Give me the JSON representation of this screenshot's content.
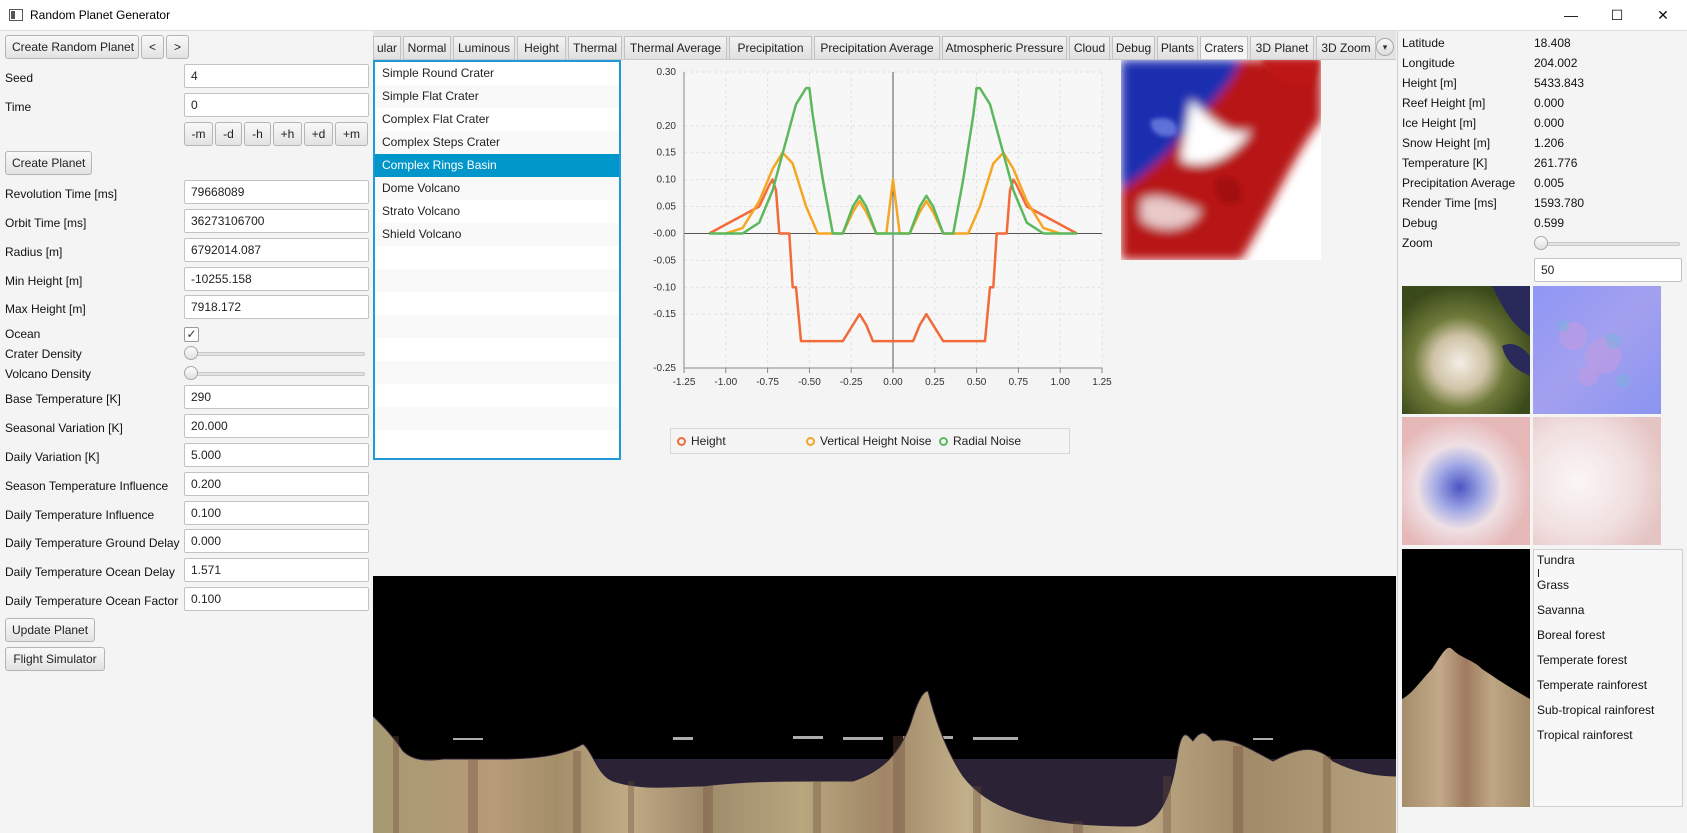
{
  "window": {
    "title": "Random Planet Generator",
    "minimize": "—",
    "maximize": "☐",
    "close": "✕"
  },
  "left": {
    "create_random_planet": "Create Random Planet",
    "prev": "<",
    "next": ">",
    "seed_label": "Seed",
    "seed_value": "4",
    "time_label": "Time",
    "time_value": "0",
    "time_buttons": [
      "-m",
      "-d",
      "-h",
      "+h",
      "+d",
      "+m"
    ],
    "create_planet": "Create Planet",
    "revolution_time_label": "Revolution Time [ms]",
    "revolution_time_value": "79668089",
    "orbit_time_label": "Orbit Time [ms]",
    "orbit_time_value": "36273106700",
    "radius_label": "Radius [m]",
    "radius_value": "6792014.087",
    "min_height_label": "Min Height [m]",
    "min_height_value": "-10255.158",
    "max_height_label": "Max Height [m]",
    "max_height_value": "7918.172",
    "ocean_label": "Ocean",
    "ocean_checked": "✓",
    "crater_density_label": "Crater Density",
    "crater_density_value": 0,
    "volcano_density_label": "Volcano Density",
    "volcano_density_value": 0,
    "base_temperature_label": "Base Temperature [K]",
    "base_temperature_value": "290",
    "seasonal_variation_label": "Seasonal Variation [K]",
    "seasonal_variation_value": "20.000",
    "daily_variation_label": "Daily Variation [K]",
    "daily_variation_value": "5.000",
    "season_temp_influence_label": "Season Temperature Influence",
    "season_temp_influence_value": "0.200",
    "daily_temp_influence_label": "Daily Temperature Influence",
    "daily_temp_influence_value": "0.100",
    "daily_temp_ground_delay_label": "Daily Temperature Ground Delay",
    "daily_temp_ground_delay_value": "0.000",
    "daily_temp_ocean_delay_label": "Daily Temperature Ocean Delay",
    "daily_temp_ocean_delay_value": "1.571",
    "daily_temp_ocean_factor_label": "Daily Temperature Ocean Factor",
    "daily_temp_ocean_factor_value": "0.100",
    "update_planet": "Update Planet",
    "flight_simulator": "Flight Simulator"
  },
  "tabs": [
    "ular",
    "Normal",
    "Luminous",
    "Height",
    "Thermal",
    "Thermal Average",
    "Precipitation",
    "Precipitation Average",
    "Atmospheric Pressure",
    "Cloud",
    "Debug",
    "Plants",
    "Craters",
    "3D Planet",
    "3D Zoom"
  ],
  "active_tab": "Craters",
  "tab_more_icon": "▾",
  "crater_list": {
    "items": [
      "Simple Round Crater",
      "Simple Flat Crater",
      "Complex Flat Crater",
      "Complex Steps Crater",
      "Complex Rings Basin",
      "Dome Volcano",
      "Strato Volcano",
      "Shield Volcano"
    ],
    "selected": "Complex Rings Basin"
  },
  "chart_data": {
    "type": "line",
    "title": "",
    "xlabel": "",
    "ylabel": "",
    "xlim": [
      -1.25,
      1.25
    ],
    "ylim": [
      -0.25,
      0.3
    ],
    "x_ticks": [
      "-1.25",
      "-1.00",
      "-0.75",
      "-0.50",
      "-0.25",
      "0.00",
      "0.25",
      "0.50",
      "0.75",
      "1.00",
      "1.25"
    ],
    "y_ticks": [
      "0.30",
      "0.20",
      "0.15",
      "0.10",
      "0.05",
      "-0.00",
      "-0.05",
      "-0.10",
      "-0.15",
      "-0.25"
    ],
    "grid": true,
    "legend": "bottom",
    "series": [
      {
        "name": "Height",
        "color": "#f26b3a",
        "x": [
          -1.1,
          -0.8,
          -0.74,
          -0.72,
          -0.7,
          -0.68,
          -0.66,
          -0.64,
          -0.62,
          -0.6,
          -0.58,
          -0.55,
          -0.5,
          -0.3,
          -0.24,
          -0.2,
          -0.16,
          -0.12,
          -0.05,
          0.05,
          0.12,
          0.16,
          0.2,
          0.24,
          0.3,
          0.5,
          0.55,
          0.58,
          0.6,
          0.62,
          0.64,
          0.66,
          0.68,
          0.7,
          0.72,
          0.74,
          0.8,
          1.1
        ],
        "y": [
          0.0,
          0.05,
          0.09,
          0.1,
          0.08,
          0.0,
          0.0,
          0.0,
          0.0,
          -0.1,
          -0.1,
          -0.2,
          -0.2,
          -0.2,
          -0.17,
          -0.15,
          -0.17,
          -0.2,
          -0.2,
          -0.2,
          -0.2,
          -0.17,
          -0.15,
          -0.17,
          -0.2,
          -0.2,
          -0.2,
          -0.1,
          -0.1,
          0.0,
          0.0,
          0.0,
          0.0,
          0.08,
          0.1,
          0.09,
          0.05,
          0.0
        ]
      },
      {
        "name": "Vertical Height Noise",
        "color": "#f5a623",
        "x": [
          -1.0,
          -0.9,
          -0.8,
          -0.72,
          -0.66,
          -0.6,
          -0.52,
          -0.45,
          -0.4,
          -0.3,
          -0.24,
          -0.2,
          -0.16,
          -0.1,
          -0.04,
          0.0,
          0.04,
          0.1,
          0.16,
          0.2,
          0.24,
          0.3,
          0.4,
          0.45,
          0.52,
          0.6,
          0.66,
          0.72,
          0.8,
          0.9,
          1.0
        ],
        "y": [
          0.0,
          0.01,
          0.06,
          0.12,
          0.15,
          0.13,
          0.05,
          0.0,
          0.0,
          0.0,
          0.04,
          0.06,
          0.04,
          0.0,
          0.0,
          0.1,
          0.0,
          0.0,
          0.04,
          0.06,
          0.04,
          0.0,
          0.0,
          0.0,
          0.05,
          0.13,
          0.15,
          0.12,
          0.06,
          0.01,
          0.0
        ]
      },
      {
        "name": "Radial Noise",
        "color": "#5cb85c",
        "x": [
          -1.1,
          -0.9,
          -0.8,
          -0.72,
          -0.65,
          -0.58,
          -0.52,
          -0.5,
          -0.48,
          -0.42,
          -0.36,
          -0.3,
          -0.24,
          -0.2,
          -0.16,
          -0.1,
          -0.05,
          0.0,
          0.05,
          0.1,
          0.16,
          0.2,
          0.24,
          0.3,
          0.36,
          0.42,
          0.48,
          0.5,
          0.52,
          0.58,
          0.65,
          0.72,
          0.8,
          0.9,
          1.1
        ],
        "y": [
          0.0,
          0.0,
          0.02,
          0.08,
          0.16,
          0.24,
          0.27,
          0.27,
          0.22,
          0.1,
          0.0,
          0.0,
          0.05,
          0.07,
          0.05,
          0.0,
          0.0,
          0.0,
          0.0,
          0.0,
          0.05,
          0.07,
          0.05,
          0.0,
          0.0,
          0.1,
          0.22,
          0.27,
          0.27,
          0.24,
          0.16,
          0.08,
          0.02,
          0.0,
          0.0
        ]
      }
    ]
  },
  "info": {
    "rows": [
      {
        "key": "Latitude",
        "value": "18.408"
      },
      {
        "key": "Longitude",
        "value": "204.002"
      },
      {
        "key": "Height [m]",
        "value": "5433.843"
      },
      {
        "key": "Reef Height [m]",
        "value": "0.000"
      },
      {
        "key": "Ice Height [m]",
        "value": "0.000"
      },
      {
        "key": "Snow Height [m]",
        "value": "1.206"
      },
      {
        "key": "Temperature [K]",
        "value": "261.776"
      },
      {
        "key": "Precipitation Average",
        "value": "0.005"
      },
      {
        "key": "Render Time [ms]",
        "value": "1593.780"
      },
      {
        "key": "Debug",
        "value": "0.599"
      }
    ],
    "zoom_label": "Zoom",
    "zoom_value": "50",
    "zoom_level": 0
  },
  "biomes": [
    "Tundra",
    "Grass",
    "Savanna",
    "Boreal forest",
    "Temperate forest",
    "Temperate rainforest",
    "Sub-tropical rainforest",
    "Tropical rainforest"
  ],
  "colors": {
    "accent": "#0096c9",
    "focus": "#1f9ad6"
  }
}
